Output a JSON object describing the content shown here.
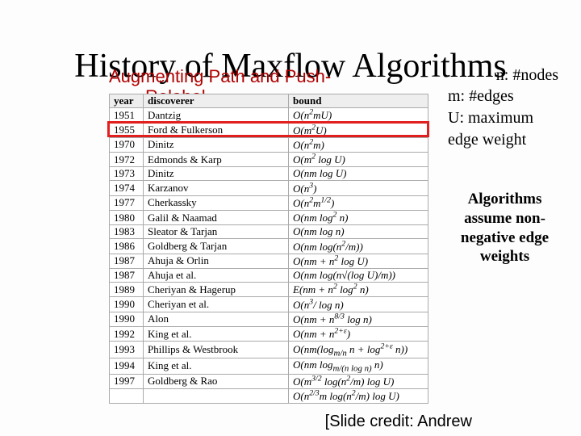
{
  "title": "History of Maxflow Algorithms",
  "subtitle_line1": "Augmenting Path and Push-",
  "subtitle_line2": "Relabel",
  "legend": {
    "n": "n: #nodes",
    "m": "m: #edges",
    "u1": "U: maximum",
    "u2": "edge weight"
  },
  "sidenote": "Algorithms assume non-negative edge weights",
  "credit": "[Slide credit: Andrew",
  "headers": {
    "c1": "year",
    "c2": "discoverer",
    "c3": "bound"
  },
  "rows": [
    {
      "year": "1951",
      "disc": "Dantzig",
      "bound_html": "O(n<sup>2</sup>mU)"
    },
    {
      "year": "1955",
      "disc": "Ford & Fulkerson",
      "bound_html": "O(m<sup>2</sup>U)"
    },
    {
      "year": "1970",
      "disc": "Dinitz",
      "bound_html": "O(n<sup>2</sup>m)"
    },
    {
      "year": "1972",
      "disc": "Edmonds & Karp",
      "bound_html": "O(m<sup>2</sup> log U)"
    },
    {
      "year": "1973",
      "disc": "Dinitz",
      "bound_html": "O(nm log U)"
    },
    {
      "year": "1974",
      "disc": "Karzanov",
      "bound_html": "O(n<sup>3</sup>)"
    },
    {
      "year": "1977",
      "disc": "Cherkassky",
      "bound_html": "O(n<sup>2</sup>m<sup>1/2</sup>)"
    },
    {
      "year": "1980",
      "disc": "Galil & Naamad",
      "bound_html": "O(nm log<sup>2</sup> n)"
    },
    {
      "year": "1983",
      "disc": "Sleator & Tarjan",
      "bound_html": "O(nm log n)"
    },
    {
      "year": "1986",
      "disc": "Goldberg & Tarjan",
      "bound_html": "O(nm log(n<sup>2</sup>/m))"
    },
    {
      "year": "1987",
      "disc": "Ahuja & Orlin",
      "bound_html": "O(nm + n<sup>2</sup> log U)"
    },
    {
      "year": "1987",
      "disc": "Ahuja et al.",
      "bound_html": "O(nm log(n√(log U)/m))"
    },
    {
      "year": "1989",
      "disc": "Cheriyan & Hagerup",
      "bound_html": "E(nm + n<sup>2</sup> log<sup>2</sup> n)"
    },
    {
      "year": "1990",
      "disc": "Cheriyan et al.",
      "bound_html": "O(n<sup>3</sup>/ log n)"
    },
    {
      "year": "1990",
      "disc": "Alon",
      "bound_html": "O(nm + n<sup>8/3</sup> log n)"
    },
    {
      "year": "1992",
      "disc": "King et al.",
      "bound_html": "O(nm + n<sup>2+ε</sup>)"
    },
    {
      "year": "1993",
      "disc": "Phillips & Westbrook",
      "bound_html": "O(nm(log<sub>m/n</sub> n + log<sup>2+ε</sup> n))"
    },
    {
      "year": "1994",
      "disc": "King et al.",
      "bound_html": "O(nm log<sub>m/(n log n)</sub> n)"
    },
    {
      "year": "1997",
      "disc": "Goldberg & Rao",
      "bound_html": "O(m<sup>3/2</sup> log(n<sup>2</sup>/m) log U)"
    },
    {
      "year": "",
      "disc": "",
      "bound_html": "O(n<sup>2/3</sup>m log(n<sup>2</sup>/m) log U)"
    }
  ],
  "highlight_row_index": 1
}
